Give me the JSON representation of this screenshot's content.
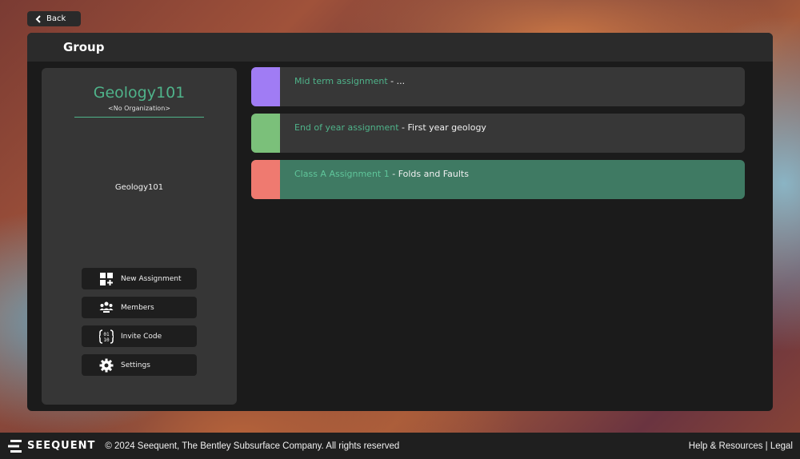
{
  "back": {
    "label": "Back"
  },
  "header": {
    "title": "Group"
  },
  "sidebar": {
    "group_name": "Geology101",
    "organization": "<No Organization>",
    "description": "Geology101",
    "buttons": {
      "new_assignment": "New Assignment",
      "members": "Members",
      "invite_code": "Invite Code",
      "settings": "Settings"
    }
  },
  "assignments": [
    {
      "name": "Mid term assignment",
      "separator": " - ",
      "subtitle": "...",
      "color": "#a07cf4"
    },
    {
      "name": "End of year assignment",
      "separator": " - ",
      "subtitle": "First year geology",
      "color": "#7bc07a"
    },
    {
      "name": "Class A Assignment 1",
      "separator": " - ",
      "subtitle": "Folds and Faults",
      "color": "#ef7a70"
    }
  ],
  "footer": {
    "brand": "SEEQUENT",
    "copyright": "© 2024 Seequent, The Bentley Subsurface Company. All rights reserved",
    "links": "Help & Resources | Legal"
  },
  "colors": {
    "accent": "#4fb38a",
    "selected_row": "#3f7a63"
  }
}
